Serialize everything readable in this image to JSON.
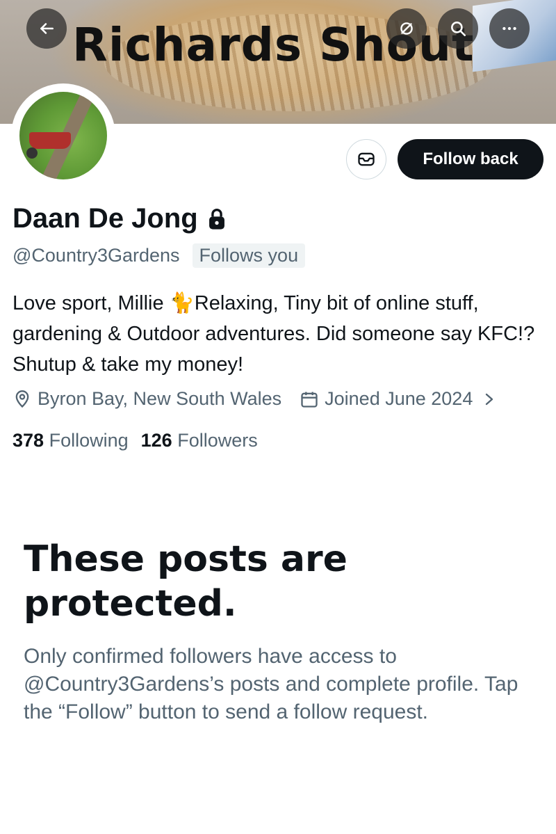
{
  "banner": {
    "title": "Richards Shout"
  },
  "header": {
    "back_icon": "arrow-left-icon",
    "mute_icon": "no-notification-icon",
    "search_icon": "search-icon",
    "more_icon": "more-horizontal-icon"
  },
  "actions": {
    "message_icon": "envelope-icon",
    "follow_label": "Follow back"
  },
  "profile": {
    "name": "Daan De Jong",
    "handle": "@Country3Gardens",
    "follows_badge": "Follows you",
    "bio": "Love sport, Millie 🐈Relaxing, Tiny bit of online stuff, gardening & Outdoor adventures. Did someone say KFC!? Shutup & take my money!",
    "location": "Byron Bay, New South Wales",
    "joined": "Joined June 2024",
    "following_count": "378",
    "following_label": "Following",
    "followers_count": "126",
    "followers_label": "Followers"
  },
  "protected": {
    "title": "These posts are protected.",
    "description": "Only confirmed followers have access to @Country3Gardens’s posts and complete profile. Tap the “Follow” button to send a follow request."
  },
  "colors": {
    "primary_text": "#0f1419",
    "secondary_text": "#536471",
    "button_bg": "#0f1419"
  }
}
